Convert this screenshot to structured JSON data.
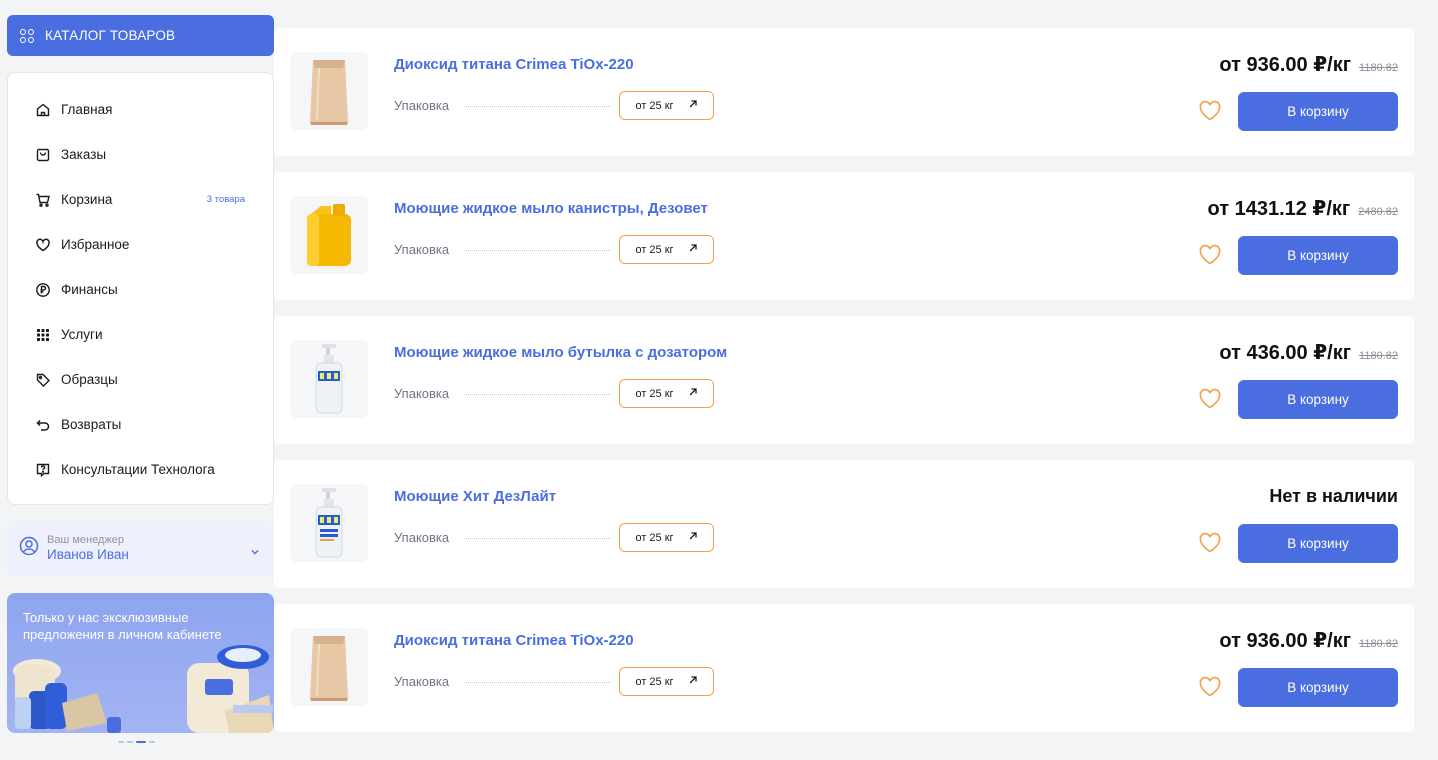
{
  "sidebar": {
    "catalog_label": "КАТАЛОГ ТОВАРОВ",
    "menu": [
      {
        "label": "Главная",
        "icon": "home-icon"
      },
      {
        "label": "Заказы",
        "icon": "bag-icon"
      },
      {
        "label": "Корзина",
        "icon": "cart-icon",
        "badge": "3 товара"
      },
      {
        "label": "Избранное",
        "icon": "heart-icon"
      },
      {
        "label": "Финансы",
        "icon": "ruble-icon"
      },
      {
        "label": "Услуги",
        "icon": "grid-dots-icon"
      },
      {
        "label": "Образцы",
        "icon": "tag-icon"
      },
      {
        "label": "Возвраты",
        "icon": "return-arrow-icon"
      },
      {
        "label": "Консультации Технолога",
        "icon": "question-chat-icon"
      }
    ],
    "manager": {
      "label": "Ваш менеджер",
      "name": "Иванов Иван"
    },
    "promo": {
      "text": "Только у нас эксклюзивные предложения в личном кабинете"
    }
  },
  "products": [
    {
      "title": "Диоксид титана Crimea TiOx-220",
      "pack_label": "Упаковка",
      "pack_value": "от 25 кг",
      "price": "от 936.00 ₽/кг",
      "old_price": "1180.82",
      "in_stock": true,
      "cart_label": "В корзину",
      "image": "paper-sack"
    },
    {
      "title": "Моющие жидкое мыло канистры, Дезовет",
      "pack_label": "Упаковка",
      "pack_value": "от 25 кг",
      "price": "от 1431.12 ₽/кг",
      "old_price": "2480.82",
      "in_stock": true,
      "cart_label": "В корзину",
      "image": "yellow-canister"
    },
    {
      "title": "Моющие жидкое мыло бутылка с дозатором",
      "pack_label": "Упаковка",
      "pack_value": "от 25 кг",
      "price": "от 436.00 ₽/кг",
      "old_price": "1180.82",
      "in_stock": true,
      "cart_label": "В корзину",
      "image": "pump-bottle"
    },
    {
      "title": "Моющие Хит ДезЛайт",
      "pack_label": "Упаковка",
      "pack_value": "от 25 кг",
      "stock_text": "Нет в наличии",
      "in_stock": false,
      "cart_label": "В корзину",
      "image": "pump-bottle"
    },
    {
      "title": "Диоксид титана Crimea TiOx-220",
      "pack_label": "Упаковка",
      "pack_value": "от 25 кг",
      "price": "от 936.00 ₽/кг",
      "old_price": "1180.82",
      "in_stock": true,
      "cart_label": "В корзину",
      "image": "paper-sack"
    }
  ],
  "colors": {
    "accent": "#4a6ee0",
    "favorite": "#f0a04b"
  }
}
